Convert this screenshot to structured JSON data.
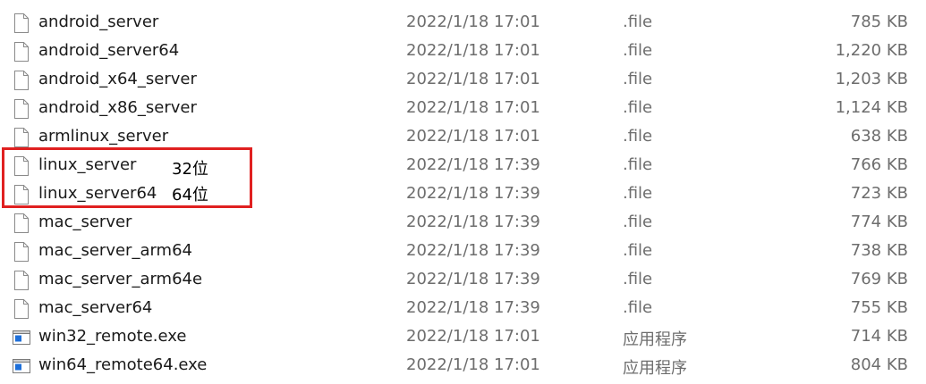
{
  "files": [
    {
      "name": "android_server",
      "date": "2022/1/18 17:01",
      "type": ".file",
      "size": "785 KB",
      "icon": "blank-file-icon"
    },
    {
      "name": "android_server64",
      "date": "2022/1/18 17:01",
      "type": ".file",
      "size": "1,220 KB",
      "icon": "blank-file-icon"
    },
    {
      "name": "android_x64_server",
      "date": "2022/1/18 17:01",
      "type": ".file",
      "size": "1,203 KB",
      "icon": "blank-file-icon"
    },
    {
      "name": "android_x86_server",
      "date": "2022/1/18 17:01",
      "type": ".file",
      "size": "1,124 KB",
      "icon": "blank-file-icon"
    },
    {
      "name": "armlinux_server",
      "date": "2022/1/18 17:01",
      "type": ".file",
      "size": "638 KB",
      "icon": "blank-file-icon"
    },
    {
      "name": "linux_server",
      "date": "2022/1/18 17:39",
      "type": ".file",
      "size": "766 KB",
      "icon": "blank-file-icon"
    },
    {
      "name": "linux_server64",
      "date": "2022/1/18 17:39",
      "type": ".file",
      "size": "723 KB",
      "icon": "blank-file-icon"
    },
    {
      "name": "mac_server",
      "date": "2022/1/18 17:39",
      "type": ".file",
      "size": "774 KB",
      "icon": "blank-file-icon"
    },
    {
      "name": "mac_server_arm64",
      "date": "2022/1/18 17:39",
      "type": ".file",
      "size": "738 KB",
      "icon": "blank-file-icon"
    },
    {
      "name": "mac_server_arm64e",
      "date": "2022/1/18 17:39",
      "type": ".file",
      "size": "769 KB",
      "icon": "blank-file-icon"
    },
    {
      "name": "mac_server64",
      "date": "2022/1/18 17:39",
      "type": ".file",
      "size": "755 KB",
      "icon": "blank-file-icon"
    },
    {
      "name": "win32_remote.exe",
      "date": "2022/1/18 17:01",
      "type": "应用程序",
      "size": "714 KB",
      "icon": "application-icon"
    },
    {
      "name": "win64_remote64.exe",
      "date": "2022/1/18 17:01",
      "type": "应用程序",
      "size": "804 KB",
      "icon": "application-icon"
    }
  ],
  "annotations": {
    "label_32": "32位",
    "label_64": "64位",
    "box_color": "#e02020"
  }
}
